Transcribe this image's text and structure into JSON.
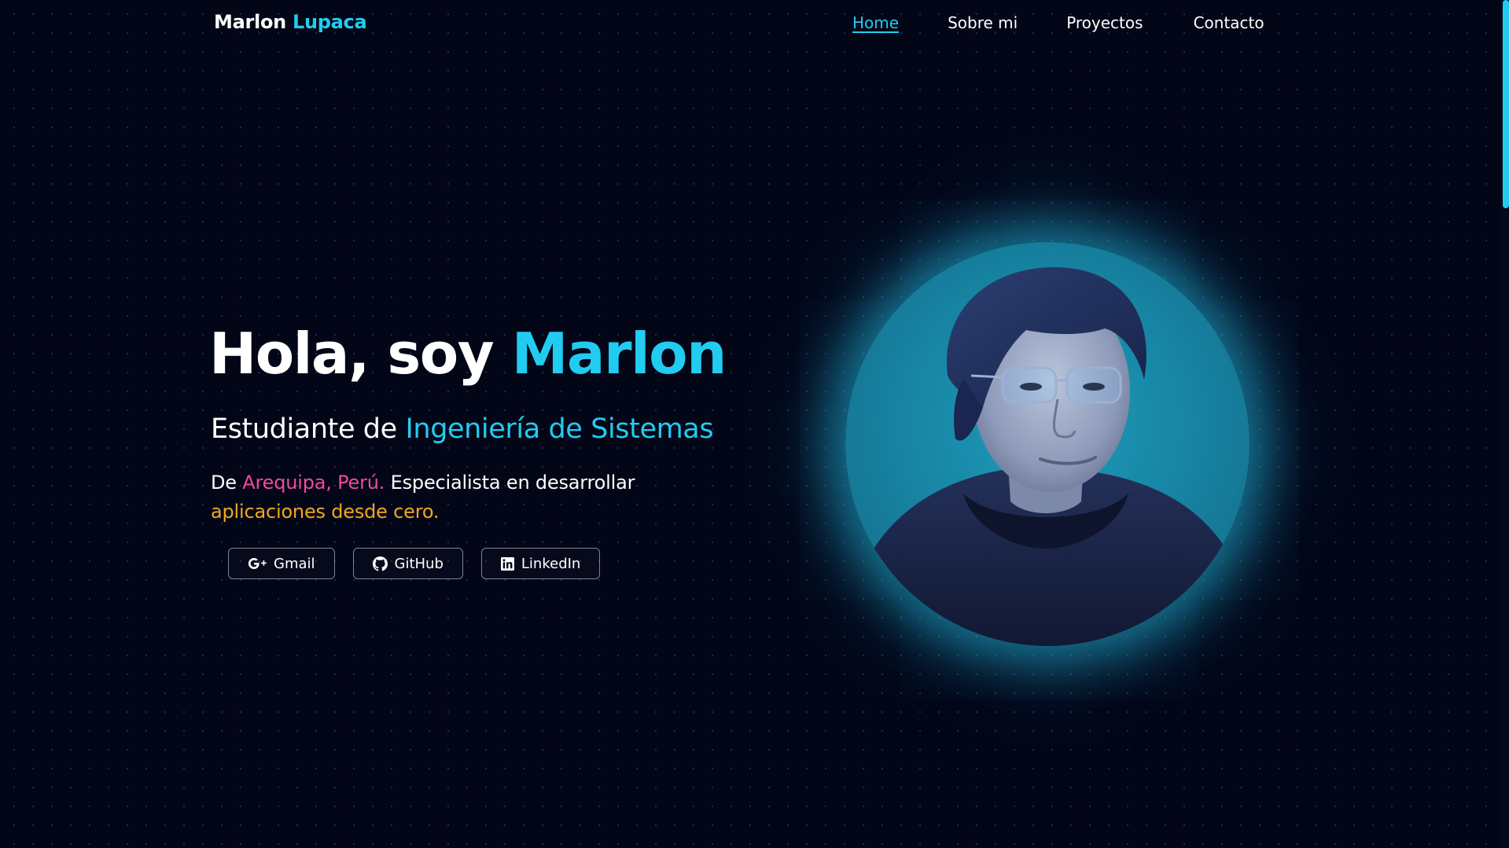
{
  "header": {
    "brand": {
      "first": "Marlon",
      "last": "Lupaca"
    },
    "nav": [
      {
        "label": "Home",
        "active": true
      },
      {
        "label": "Sobre mi"
      },
      {
        "label": "Proyectos"
      },
      {
        "label": "Contacto"
      }
    ]
  },
  "hero": {
    "title_prefix": "Hola, soy ",
    "title_name": "Marlon",
    "subtitle_prefix": "Estudiante de ",
    "subtitle_field": "Ingeniería de Sistemas",
    "desc_start": "De ",
    "desc_location": "Arequipa, Perú.",
    "desc_middle": " Especialista en desarrollar ",
    "desc_highlight": "aplicaciones desde cero."
  },
  "social": [
    {
      "label": "Gmail",
      "icon": "google-plus-icon"
    },
    {
      "label": "GitHub",
      "icon": "github-icon"
    },
    {
      "label": "LinkedIn",
      "icon": "linkedin-icon"
    }
  ],
  "portrait": {
    "subject": "profile-photo"
  },
  "colors": {
    "background": "#030617",
    "accent": "#22ccf0",
    "pink": "#ee4c9a",
    "gold": "#f0a81e"
  }
}
